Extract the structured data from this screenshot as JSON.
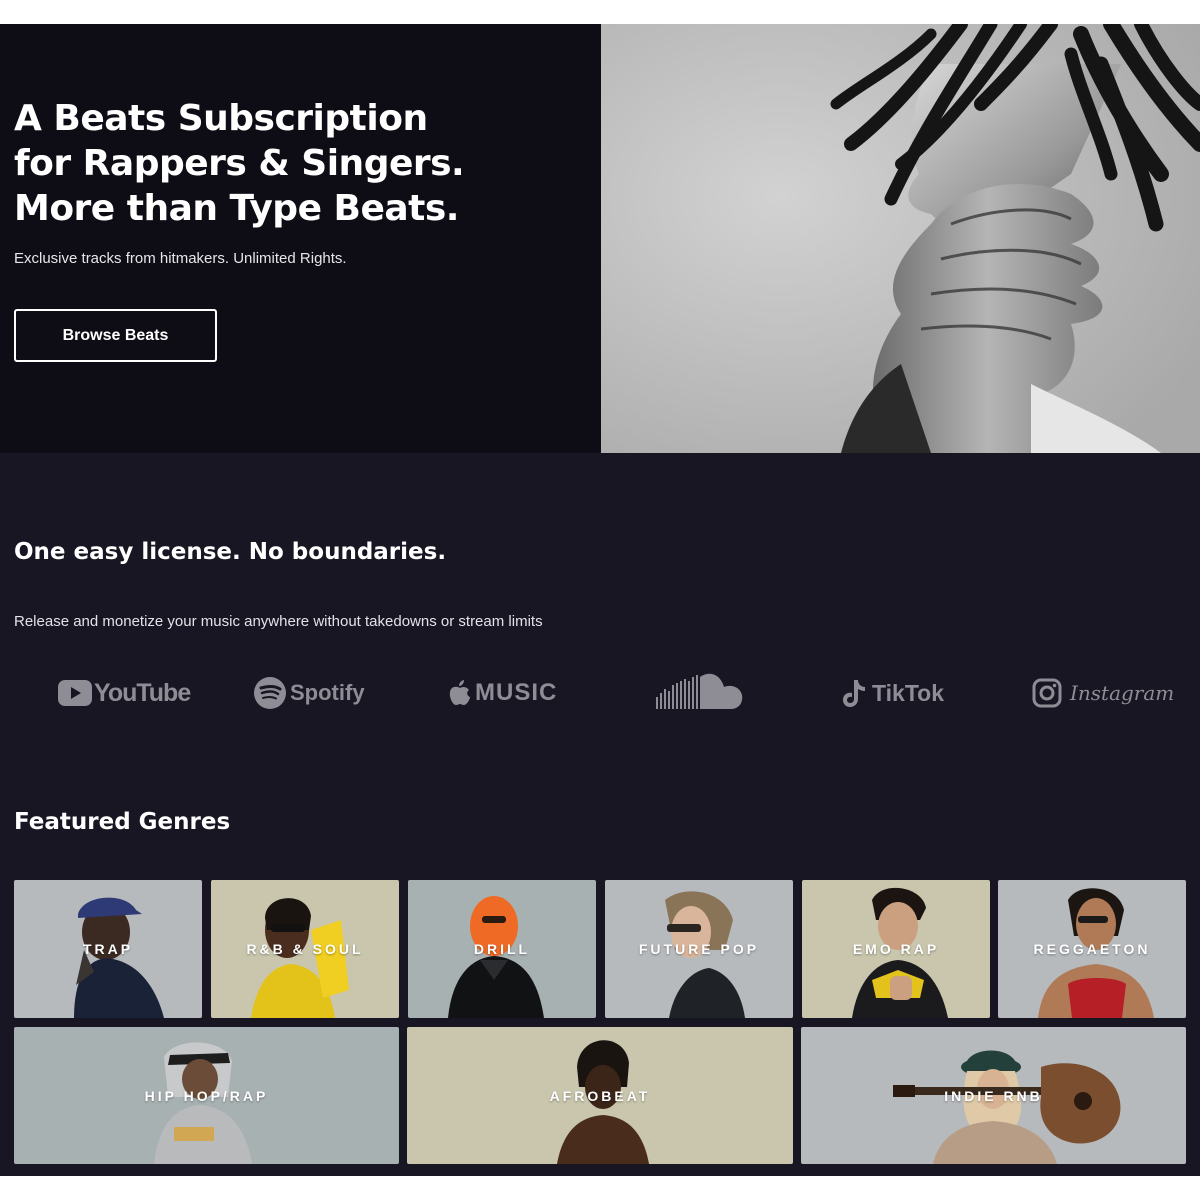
{
  "hero": {
    "title_lines": [
      "A Beats Subscription",
      "for Rappers & Singers.",
      "More than Type Beats."
    ],
    "subtitle": "Exclusive tracks from hitmakers. Unlimited Rights.",
    "cta_label": "Browse Beats"
  },
  "license": {
    "title": "One easy license. No boundaries.",
    "subtitle": "Release and monetize your music anywhere without takedowns or stream limits"
  },
  "platforms": [
    {
      "name": "YouTube",
      "icon": "youtube-icon"
    },
    {
      "name": "Spotify",
      "icon": "spotify-icon"
    },
    {
      "name": "MUSIC",
      "icon": "apple-icon"
    },
    {
      "name": "SoundCloud",
      "icon": "soundcloud-icon"
    },
    {
      "name": "TikTok",
      "icon": "tiktok-icon"
    },
    {
      "name": "Instagram",
      "icon": "instagram-icon"
    }
  ],
  "genres": {
    "title": "Featured Genres",
    "row1": [
      "TRAP",
      "R&B & SOUL",
      "DRILL",
      "FUTURE POP",
      "EMO RAP",
      "REGGAETON"
    ],
    "row2": [
      "HIP HOP/RAP",
      "AFROBEAT",
      "INDIE RNB"
    ]
  },
  "colors": {
    "hero_bg": "#0e0d16",
    "section_bg": "#181622",
    "logo_gray": "#8e8d95",
    "tile_gray": "#b6babd",
    "tile_beige": "#c9c6ad",
    "tile_blue_gray": "#a8b1b2"
  }
}
